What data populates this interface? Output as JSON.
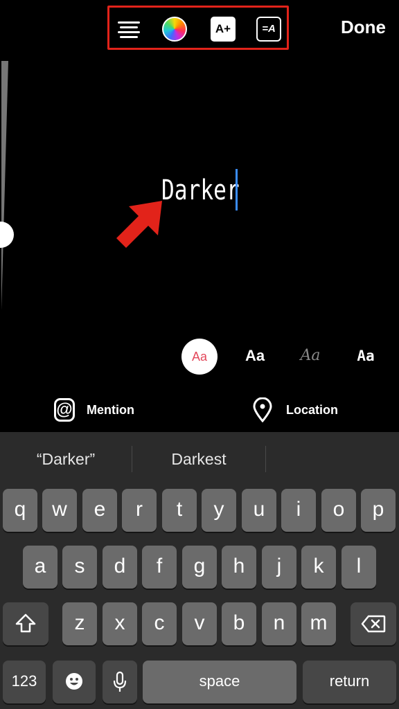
{
  "toolbar": {
    "icons": [
      "align-icon",
      "color-wheel-icon",
      "text-effects-icon",
      "animate-text-icon"
    ],
    "effects_label": "A+",
    "anim_label": "=A",
    "highlight_color": "#e2231a"
  },
  "done_label": "Done",
  "editor": {
    "text": "Darker",
    "caret_color": "#3a8dff",
    "arrow_color": "#e2231a"
  },
  "font_styles": [
    "Aa",
    "Aa",
    "Aa",
    "Aa"
  ],
  "mention": {
    "label": "Mention",
    "icon": "@"
  },
  "location": {
    "label": "Location",
    "icon": "location-pin-icon"
  },
  "suggestions": [
    "“Darker”",
    "Darkest",
    ""
  ],
  "keyboard": {
    "row1": [
      "q",
      "w",
      "e",
      "r",
      "t",
      "y",
      "u",
      "i",
      "o",
      "p"
    ],
    "row2": [
      "a",
      "s",
      "d",
      "f",
      "g",
      "h",
      "j",
      "k",
      "l"
    ],
    "row3": [
      "z",
      "x",
      "c",
      "v",
      "b",
      "n",
      "m"
    ],
    "numbers_label": "123",
    "space_label": "space",
    "return_label": "return",
    "icons": [
      "shift-icon",
      "delete-icon",
      "emoji-icon",
      "microphone-icon"
    ]
  }
}
